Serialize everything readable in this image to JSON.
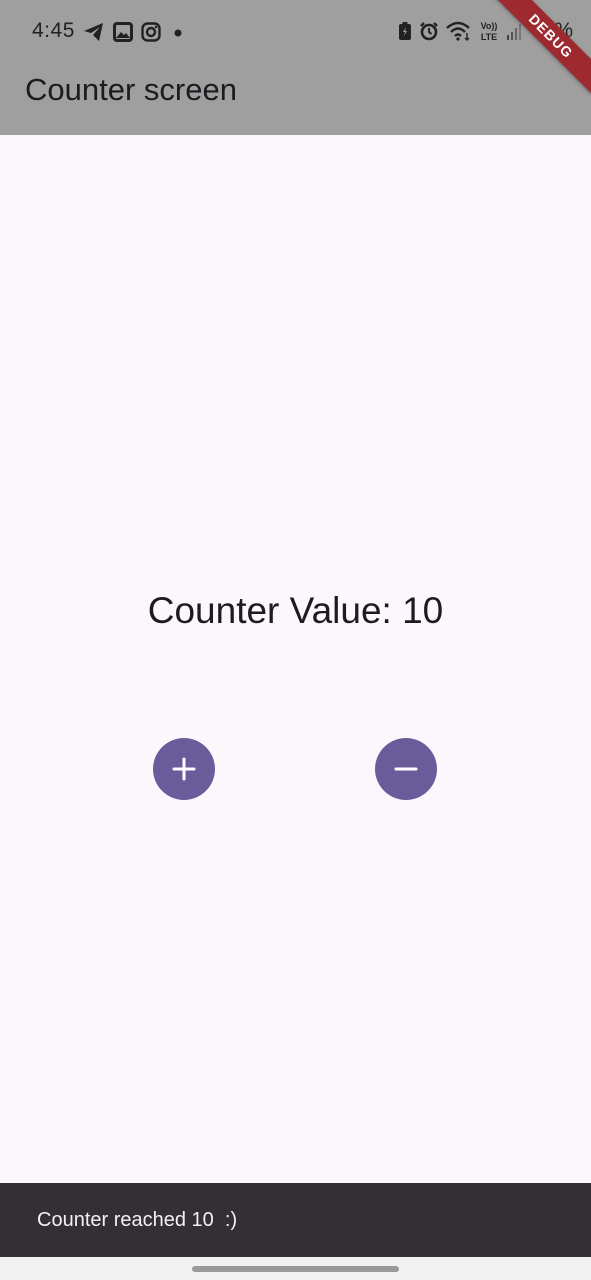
{
  "status_bar": {
    "time": "4:45",
    "left_icons": [
      "telegram-icon",
      "gallery-icon",
      "instagram-icon",
      "notification-dot-icon"
    ],
    "right_icons": [
      "battery-saver-icon",
      "alarm-icon",
      "wifi-icon",
      "volte-icon",
      "signal-icon"
    ],
    "volte_label_top": "Vo))",
    "volte_label_bottom": "LTE",
    "battery_percent": "63%"
  },
  "app_bar": {
    "title": "Counter screen"
  },
  "debug_banner": {
    "label": "DEBUG",
    "color": "#9e2a2f"
  },
  "main": {
    "counter_text": "Counter Value: 10",
    "increment_icon": "plus-icon",
    "decrement_icon": "minus-icon",
    "button_color": "#6a5c9a"
  },
  "snackbar": {
    "message": "Counter reached 10  :)"
  },
  "colors": {
    "app_bar_background": "#9f9f9f",
    "page_background": "#fcf7fc",
    "snackbar_background": "#322f35",
    "snackbar_text": "#f4eff4"
  }
}
